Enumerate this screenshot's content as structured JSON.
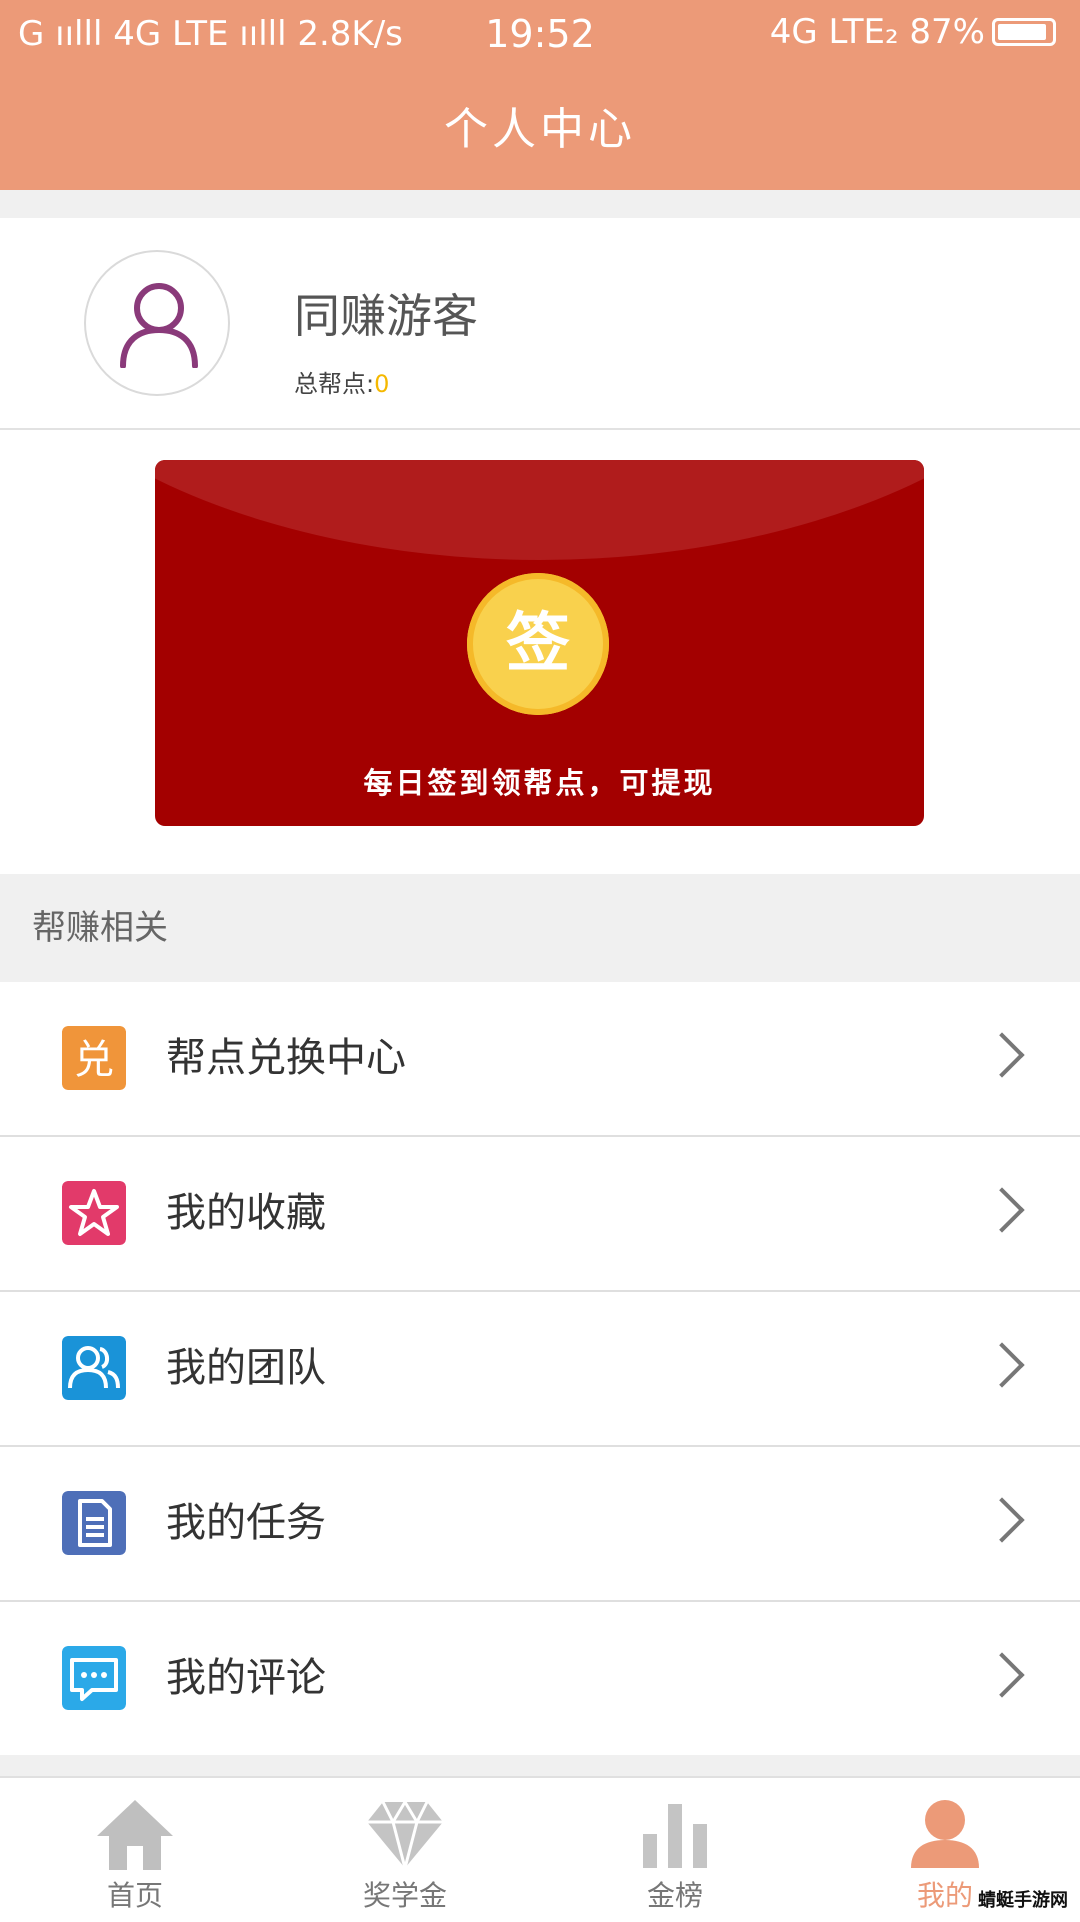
{
  "status": {
    "left": "G ıılll 4G LTE ıılll 2.8K/s",
    "time": "19:52",
    "right": "4G LTE₂ 87%"
  },
  "header": {
    "title": "个人中心"
  },
  "profile": {
    "name": "同赚游客",
    "points_label": "总帮点:",
    "points_value": "0"
  },
  "signin": {
    "coin_char": "签",
    "caption": "每日签到领帮点，可提现"
  },
  "section": {
    "title": "帮赚相关"
  },
  "menu": [
    {
      "label": "帮点兑换中心",
      "icon": "exchange-icon",
      "color": "#f0953a"
    },
    {
      "label": "我的收藏",
      "icon": "star-icon",
      "color": "#e23a6a"
    },
    {
      "label": "我的团队",
      "icon": "team-icon",
      "color": "#1a93d8"
    },
    {
      "label": "我的任务",
      "icon": "document-icon",
      "color": "#4e6fb8"
    },
    {
      "label": "我的评论",
      "icon": "comment-icon",
      "color": "#2ba9e8"
    }
  ],
  "tabs": [
    {
      "label": "首页",
      "icon": "home-icon"
    },
    {
      "label": "奖学金",
      "icon": "diamond-icon"
    },
    {
      "label": "金榜",
      "icon": "bar-chart-icon"
    },
    {
      "label": "我的",
      "icon": "person-icon"
    }
  ],
  "watermark": "蜻蜓手游网"
}
